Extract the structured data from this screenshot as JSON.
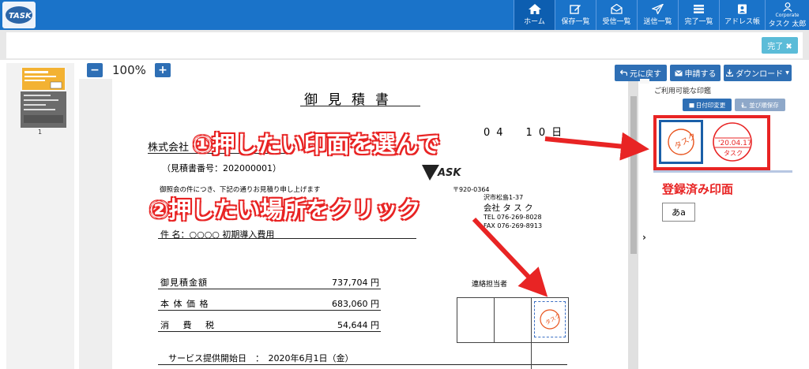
{
  "app": {
    "logo_text": "TASK"
  },
  "nav": {
    "home": "ホーム",
    "saved": "保存一覧",
    "received": "受信一覧",
    "sent": "送信一覧",
    "completed": "完了一覧",
    "address_book": "アドレス帳",
    "user_corp": "Corporate",
    "user_name": "タスク 太郎"
  },
  "toolbar": {
    "done": "完了 ✖",
    "zoom": "100%",
    "zoom_minus": "−",
    "zoom_plus": "+",
    "undo": "元に戻す",
    "request": "申請する",
    "download": "ダウンロード"
  },
  "thumbnail": {
    "page_number": "1"
  },
  "document": {
    "title": "御見積書",
    "to_company": "株式会社",
    "date": "04　10日",
    "estimate_no": "（見積書番号：202000001）",
    "greeting": "御照会の件につき、下記の通りお見積り申し上げます",
    "postal": "〒920-0364",
    "address": "沢市松島1-37",
    "sender_company": "会社 タ ス ク",
    "tel": "TEL 076-269-8028",
    "fax": "FAX 076-269-8913",
    "subject": "件 名：○○○○ 初期導入費用",
    "rows": [
      {
        "label": "御見積金額",
        "value": "737,704 円"
      },
      {
        "label": "本 体 価 格",
        "value": "683,060 円"
      },
      {
        "label": "消　 費　 税",
        "value": "54,644 円"
      }
    ],
    "contact": "連絡担当者",
    "service_start": "サービス提供開始日　：　2020年6月1日（金）"
  },
  "side": {
    "title": "ご利用可能な印鑑",
    "date_change": "日付印変更",
    "sort_save": "並び順保存",
    "stamp_name": "タスク",
    "stamp_date": "'20.04.17",
    "registered_label": "登録済み印面",
    "text_stamp": "あa"
  },
  "annotations": {
    "step1": "①押したい印面を選んで",
    "step2": "②押したい場所をクリック"
  },
  "colors": {
    "primary": "#1a73c9",
    "accent": "#e82424",
    "button": "#2e6fb5"
  }
}
